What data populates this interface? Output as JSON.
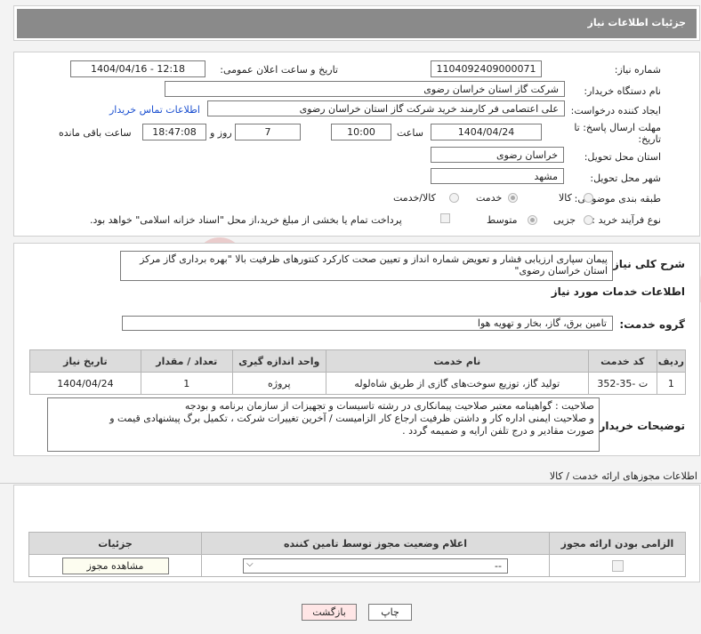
{
  "header": {
    "title": "جزئیات اطلاعات نیاز"
  },
  "form": {
    "need_number_label": "شماره نیاز:",
    "need_number": "1104092409000071",
    "announce_label": "تاریخ و ساعت اعلان عمومی:",
    "announce_value": "1404/04/16 - 12:18",
    "buyer_org_label": "نام دستگاه خریدار:",
    "buyer_org": "شرکت گاز استان خراسان رضوی",
    "creator_label": "ایجاد کننده درخواست:",
    "creator": "علی اعتصامی فر کارمند خرید شرکت گاز استان خراسان رضوی",
    "contact_link": "اطلاعات تماس خریدار",
    "deadline_label_1": "مهلت ارسال پاسخ: تا",
    "deadline_label_2": "تاریخ:",
    "deadline_date": "1404/04/24",
    "time_label": "ساعت",
    "deadline_time": "10:00",
    "days_value": "7",
    "days_label": "روز و",
    "remaining_time": "18:47:08",
    "remaining_label": "ساعت باقی مانده",
    "province_label": "استان محل تحویل:",
    "province": "خراسان رضوی",
    "city_label": "شهر محل تحویل:",
    "city": "مشهد",
    "category_label": "طبقه بندی موضوعی:",
    "category_options": [
      "کالا",
      "خدمت",
      "کالا/خدمت"
    ],
    "category_selected": 1,
    "process_label": "نوع فرآیند خرید :",
    "process_options": [
      "جزیی",
      "متوسط"
    ],
    "process_selected": 0,
    "payment_text": "پرداخت تمام یا بخشی از مبلغ خرید،از محل \"اسناد خزانه اسلامی\" خواهد بود."
  },
  "summary": {
    "label": "شرح کلی نیاز:",
    "text": "پیمان سپاری ارزیابی فشار و تعویض شماره انداز و تعیین صحت کارکرد کنتورهای ظرفیت بالا \"بهره برداری گاز مرکز استان خراسان رضوی\""
  },
  "services": {
    "section_title": "اطلاعات خدمات مورد نیاز",
    "group_label": "گروه خدمت:",
    "group_value": "تامین برق، گاز، بخار و تهویه هوا",
    "columns": [
      "ردیف",
      "کد خدمت",
      "نام خدمت",
      "واحد اندازه گیری",
      "تعداد / مقدار",
      "تاریخ نیاز"
    ],
    "rows": [
      [
        "1",
        "ت -35-352",
        "تولید گاز، توزیع سوخت‌های گازی از طریق شاه‌لوله",
        "پروژه",
        "1",
        "1404/04/24"
      ]
    ]
  },
  "buyer_notes": {
    "label": "توضیحات خریدار:",
    "lines": [
      "صلاحیت : گواهینامه معتبر صلاحیت پیمانکاری در رشته تاسیسات و تجهیزات از سازمان برنامه و بودجه",
      "و صلاحیت ایمنی اداره کار و داشتن ظرفیت ارجاع کار الزامیست  / آخرین تغییرات شرکت ، تکمیل برگ پیشنهادی قیمت و",
      "صورت مقادیر و درج تلفن ارایه و ضمیمه گردد ."
    ]
  },
  "permits": {
    "section_title": "اطلاعات مجوزهای ارائه خدمت / کالا",
    "columns": [
      "الزامی بودن ارائه مجوز",
      "اعلام وضعیت مجوز توسط تامین کننده",
      "جزئیات"
    ],
    "select_value": "--",
    "view_button": "مشاهده مجوز"
  },
  "footer": {
    "print_button": "چاپ",
    "back_button": "بازگشت"
  },
  "watermark": "AriaTender.neT",
  "colors": {
    "header_bg": "#8a8a8a",
    "link": "#1a4fd0",
    "back_btn_bg": "#ffe6e6"
  }
}
